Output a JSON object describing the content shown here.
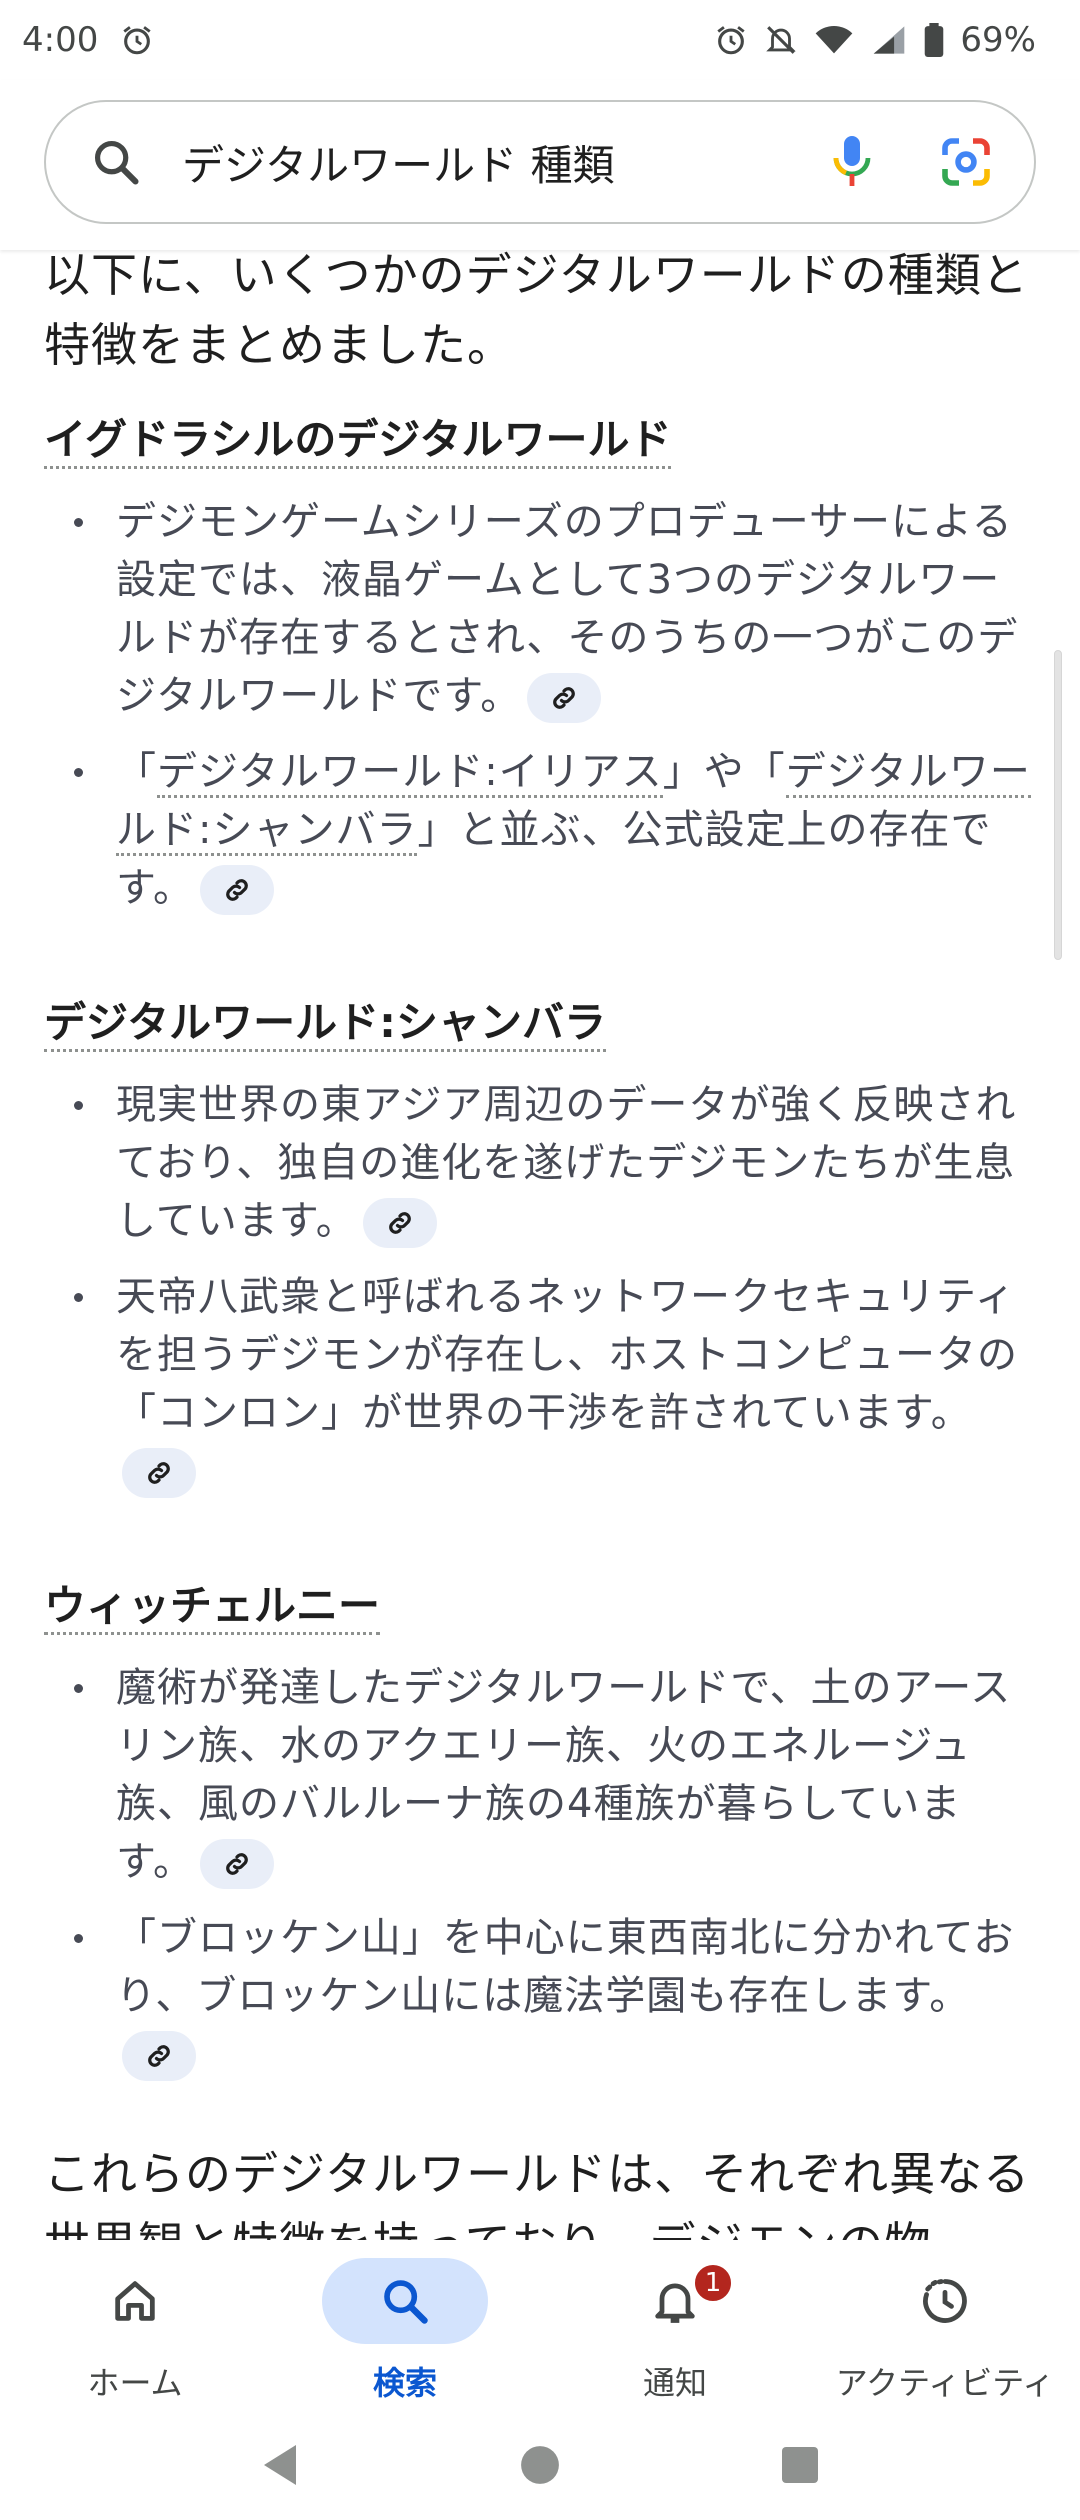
{
  "status_bar": {
    "time": "4:00",
    "battery_percent": "69%",
    "icons": [
      "alarm-icon",
      "alarm-icon",
      "mute-icon",
      "wifi-icon",
      "signal-icon",
      "battery-icon"
    ]
  },
  "search": {
    "query": "デジタルワールド 種類",
    "icons": [
      "search-icon",
      "mic-icon",
      "lens-icon"
    ]
  },
  "content": {
    "intro": "以下に、いくつかのデジタルワールドの種類と特徴をまとめました。",
    "sections": [
      {
        "title": "イグドラシルのデジタルワールド",
        "bullets": [
          "デジモンゲームシリーズのプロデューサーによる設定では、液晶ゲームとして3つのデジタルワールドが存在するとされ、そのうちの一つがこのデジタルワールドです。",
          ""
        ],
        "bullet2_parts": {
          "open1": "「",
          "link1": "デジタルワールド:イリアス",
          "mid": "」や「",
          "link2": "デジタルワールド:シャンバラ",
          "rest": "」と並ぶ、公式設定上の存在です。"
        }
      },
      {
        "title": "デジタルワールド:シャンバラ",
        "bullets": [
          "現実世界の東アジア周辺のデータが強く反映されており、独自の進化を遂げたデジモンたちが生息しています。",
          "天帝八武衆と呼ばれるネットワークセキュリティを担うデジモンが存在し、ホストコンピュータの「コンロン」が世界の干渉を許されています。"
        ]
      },
      {
        "title": "ウィッチェルニー",
        "bullets": [
          "魔術が発達したデジタルワールドで、土のアースリン族、水のアクエリー族、火のエネルージュ族、風のバルルーナ族の4種族が暮らしています。",
          "「ブロッケン山」を中心に東西南北に分かれており、ブロッケン山には魔法学園も存在します。"
        ]
      }
    ],
    "closing": "これらのデジタルワールドは、それぞれ異なる世界観と特徴を持っており、デジモンの物"
  },
  "bottom_nav": {
    "items": [
      {
        "label": "ホーム",
        "icon": "home-icon"
      },
      {
        "label": "検索",
        "icon": "search-icon",
        "active": true
      },
      {
        "label": "通知",
        "icon": "bell-icon",
        "badge": "1"
      },
      {
        "label": "アクティビティ",
        "icon": "activity-icon"
      }
    ]
  },
  "colors": {
    "accent": "#0b57d0",
    "active_pill": "#d3e3fd",
    "badge": "#b3261e",
    "bullet_text": "#474a55",
    "chip_bg": "#e9eef8"
  }
}
